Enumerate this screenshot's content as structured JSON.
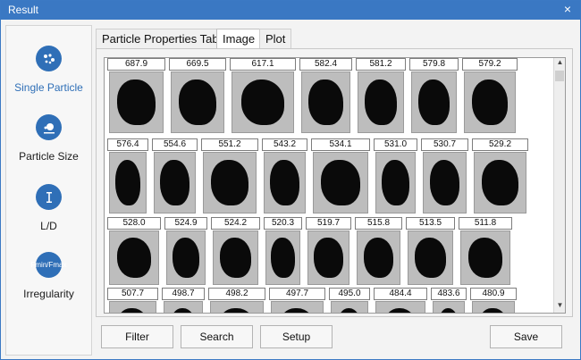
{
  "window": {
    "title": "Result",
    "close_glyph": "×"
  },
  "sidebar": {
    "items": [
      {
        "label": "Single Particle",
        "icon": "particles-icon",
        "icon_text": "",
        "active": true
      },
      {
        "label": "Particle Size",
        "icon": "particle-size-icon",
        "icon_text": "",
        "active": false
      },
      {
        "label": "L/D",
        "icon": "length-diameter-icon",
        "icon_text": "",
        "active": false
      },
      {
        "label": "Irregularity",
        "icon": "irregularity-icon",
        "icon_text": "Fmin/Fmax",
        "active": false
      }
    ]
  },
  "tabs": [
    {
      "label": "Particle Properties Table"
    },
    {
      "label": "Image",
      "active": true
    },
    {
      "label": "Plot"
    }
  ],
  "grid": {
    "rows": [
      [
        "687.9",
        "669.5",
        "617.1",
        "582.4",
        "581.2",
        "579.8",
        "579.2"
      ],
      [
        "576.4",
        "554.6",
        "551.2",
        "543.2",
        "534.1",
        "531.0",
        "530.7",
        "529.2"
      ],
      [
        "528.0",
        "524.9",
        "524.2",
        "520.3",
        "519.7",
        "515.8",
        "513.5",
        "511.8"
      ],
      [
        "507.7",
        "498.7",
        "498.2",
        "497.7",
        "495.0",
        "484.4",
        "483.6",
        "480.9"
      ]
    ]
  },
  "buttons": {
    "filter": "Filter",
    "search": "Search",
    "setup": "Setup",
    "save": "Save"
  },
  "colors": {
    "accent": "#3a78c3",
    "icon_blue": "#2f6fb7",
    "active_text": "#2f6fb7"
  }
}
